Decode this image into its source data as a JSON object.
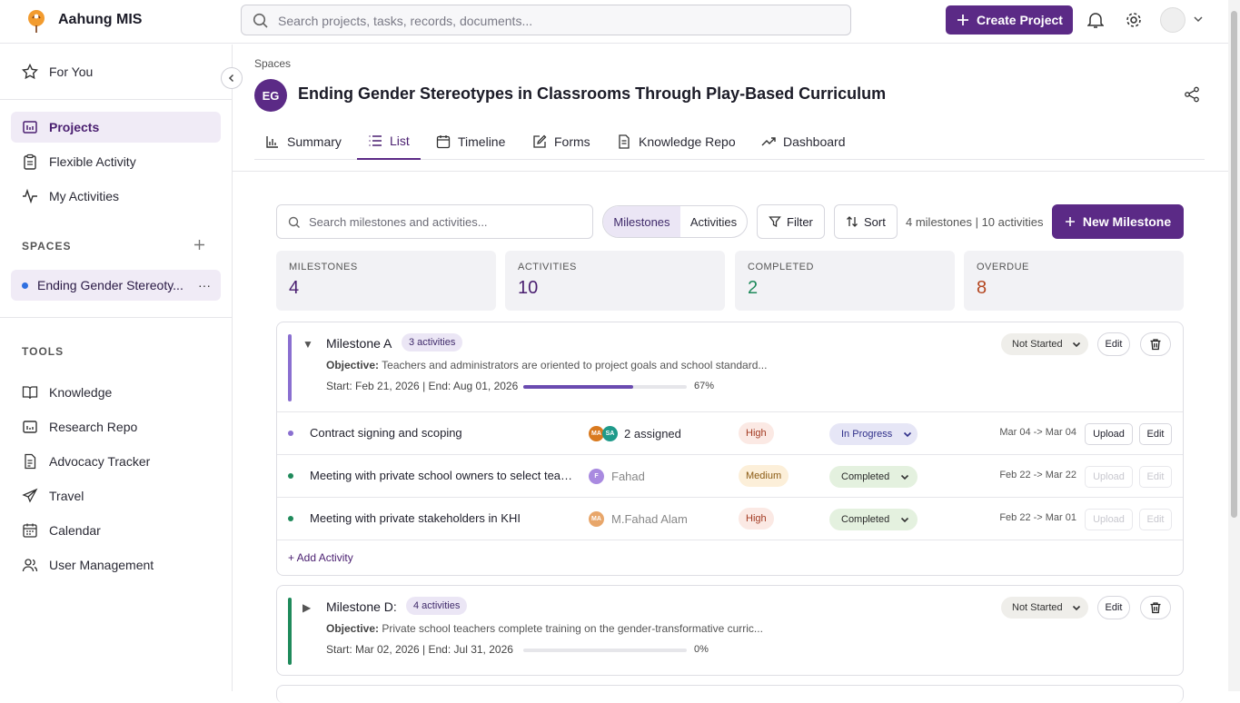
{
  "app": {
    "name": "Aahung MIS",
    "search_placeholder": "Search projects, tasks, records, documents...",
    "create_label": "Create Project"
  },
  "sidebar": {
    "for_you": "For You",
    "items": [
      {
        "label": "Projects",
        "icon": "projects-icon"
      },
      {
        "label": "Flexible Activity",
        "icon": "clipboard-icon"
      },
      {
        "label": "My Activities",
        "icon": "activity-icon"
      }
    ],
    "spaces_header": "SPACES",
    "space_item": "Ending Gender Stereoty...",
    "space_more": "···",
    "tools_header": "TOOLS",
    "tools": [
      {
        "label": "Knowledge",
        "icon": "book-icon"
      },
      {
        "label": "Research Repo",
        "icon": "folder-icon"
      },
      {
        "label": "Advocacy Tracker",
        "icon": "document-icon"
      },
      {
        "label": "Travel",
        "icon": "plane-icon"
      },
      {
        "label": "Calendar",
        "icon": "calendar-icon"
      },
      {
        "label": "User Management",
        "icon": "users-icon"
      }
    ]
  },
  "page": {
    "breadcrumb": "Spaces",
    "initials": "EG",
    "title": "Ending Gender Stereotypes in Classrooms Through Play-Based Curriculum",
    "tabs": [
      "Summary",
      "List",
      "Timeline",
      "Forms",
      "Knowledge Repo",
      "Dashboard"
    ],
    "active_tab": "List"
  },
  "toolbar": {
    "search_placeholder": "Search milestones and activities...",
    "toggle": [
      "Milestones",
      "Activities"
    ],
    "filter": "Filter",
    "sort": "Sort",
    "counts": "4 milestones | 10 activities",
    "new_milestone": "New Milestone"
  },
  "stats": [
    {
      "label": "MILESTONES",
      "value": "4",
      "color": "#4a1f70"
    },
    {
      "label": "ACTIVITIES",
      "value": "10",
      "color": "#4a1f70"
    },
    {
      "label": "COMPLETED",
      "value": "2",
      "color": "#1f8a5b"
    },
    {
      "label": "OVERDUE",
      "value": "8",
      "color": "#b4461f"
    }
  ],
  "milestones": [
    {
      "name": "Milestone A",
      "count": "3 activities",
      "objective_label": "Objective:",
      "objective": "Teachers and administrators are oriented to project goals and school standard...",
      "dates": "Start: Feb 21, 2026 | End: Aug 01, 2026",
      "progress": 67,
      "progress_label": "67%",
      "status": "Not Started",
      "edit": "Edit",
      "activities": [
        {
          "name": "Contract signing and scoping",
          "assignees": [
            "MA",
            "SA"
          ],
          "assigned": "2 assigned",
          "priority": "High",
          "status": "In Progress",
          "dates": "Mar 04 -> Mar 04",
          "upload": "Upload",
          "edit": "Edit"
        },
        {
          "name": "Meeting with private school owners to select teachers",
          "assignees": [
            "F"
          ],
          "assigned": "Fahad",
          "priority": "Medium",
          "status": "Completed",
          "dates": "Feb 22 -> Mar 22",
          "upload": "Upload",
          "edit": "Edit"
        },
        {
          "name": "Meeting with private stakeholders in KHI",
          "assignees": [
            "MA"
          ],
          "assigned": "M.Fahad Alam",
          "priority": "High",
          "status": "Completed",
          "dates": "Feb 22 -> Mar 01",
          "upload": "Upload",
          "edit": "Edit"
        }
      ],
      "add_activity": "+ Add Activity"
    },
    {
      "name": "Milestone D:",
      "count": "4 activities",
      "objective_label": "Objective:",
      "objective": "Private school teachers complete training on the gender-transformative curric...",
      "dates": "Start: Mar 02, 2026 | End: Jul 31, 2026",
      "progress": 0,
      "progress_label": "0%",
      "status": "Not Started",
      "edit": "Edit"
    }
  ]
}
